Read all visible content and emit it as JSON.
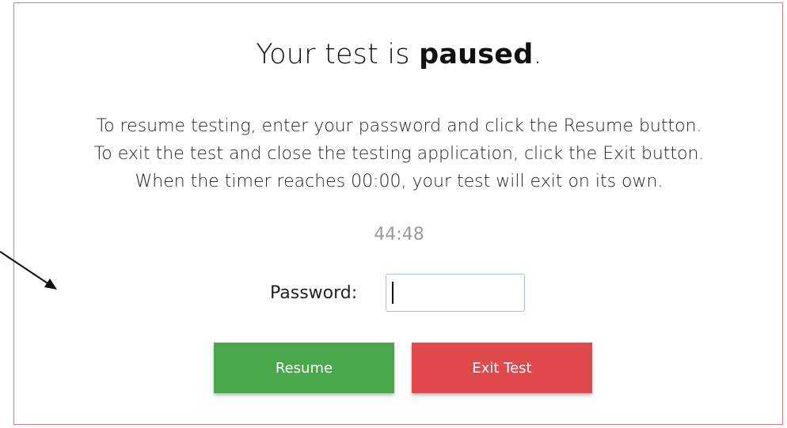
{
  "dialog": {
    "title_prefix": "Your test is ",
    "title_emphasis": "paused",
    "title_suffix": ".",
    "instructions": [
      "To resume testing, enter your password and click the Resume button.",
      "To exit the test and close the testing application, click the Exit button.",
      "When the timer reaches 00:00, your test will exit on its own."
    ],
    "timer": "44:48"
  },
  "password": {
    "label": "Password:",
    "value": "",
    "placeholder": ""
  },
  "buttons": {
    "resume_label": "Resume",
    "exit_label": "Exit Test"
  },
  "colors": {
    "border": "#e07a7a",
    "resume": "#4aa84c",
    "exit": "#e04a4d",
    "timer": "#9a9a9a",
    "input_border": "#9ec1e6"
  },
  "annotation": {
    "arrow_icon": "pointer-arrow-icon"
  }
}
